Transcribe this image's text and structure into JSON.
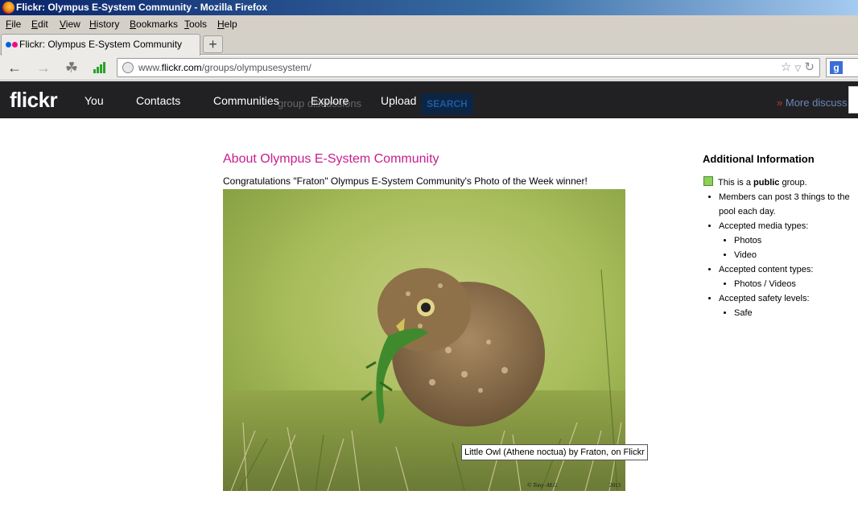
{
  "window": {
    "title": "Flickr: Olympus E-System Community - Mozilla Firefox"
  },
  "menu": [
    {
      "label": "File",
      "accel": "F",
      "rest": "ile"
    },
    {
      "label": "Edit",
      "accel": "E",
      "rest": "dit"
    },
    {
      "label": "View",
      "accel": "V",
      "rest": "iew"
    },
    {
      "label": "History",
      "accel": "H",
      "rest": "istory"
    },
    {
      "label": "Bookmarks",
      "accel": "B",
      "rest": "ookmarks"
    },
    {
      "label": "Tools",
      "accel": "T",
      "rest": "ools"
    },
    {
      "label": "Help",
      "accel": "H",
      "rest": "elp"
    }
  ],
  "tab": {
    "title": "Flickr: Olympus E-System Community",
    "new_tab_label": "+"
  },
  "url": {
    "prefix": "www.",
    "domain": "flickr.com",
    "path": "/groups/olympusesystem/"
  },
  "search_engine": {
    "icon_letter": "g"
  },
  "flickr_header": {
    "logo": "flickr",
    "nav": [
      "You",
      "Contacts",
      "Communities",
      "Explore",
      "Upload"
    ],
    "ghost_text": "group discussions",
    "search_button": "SEARCH",
    "more_link_prefix": "»",
    "more_link": "More discuss"
  },
  "about": {
    "title": "About Olympus E-System Community",
    "congrats": "Congratulations \"Fraton\" Olympus E-System Community's Photo of the Week winner!",
    "photo_caption": "© Tony -M.G",
    "photo_year": "2013",
    "tooltip": "Little Owl (Athene noctua) by Fraton, on Flickr"
  },
  "additional_info": {
    "title": "Additional Information",
    "public_prefix": "This is a",
    "public_word": "public",
    "public_suffix": "group.",
    "members_post": "Members can post 3 things to the pool each day.",
    "media_types_label": "Accepted media types:",
    "media_types": [
      "Photos",
      "Video"
    ],
    "content_types_label": "Accepted content types:",
    "content_types": [
      "Photos / Videos"
    ],
    "safety_label": "Accepted safety levels:",
    "safety_levels": [
      "Safe"
    ]
  },
  "colors": {
    "flickr_pink": "#ff0084",
    "flickr_blue": "#0063dc",
    "title_pink": "#c81e8c",
    "header_bg": "#212124",
    "public_green": "#8ccf5a"
  }
}
